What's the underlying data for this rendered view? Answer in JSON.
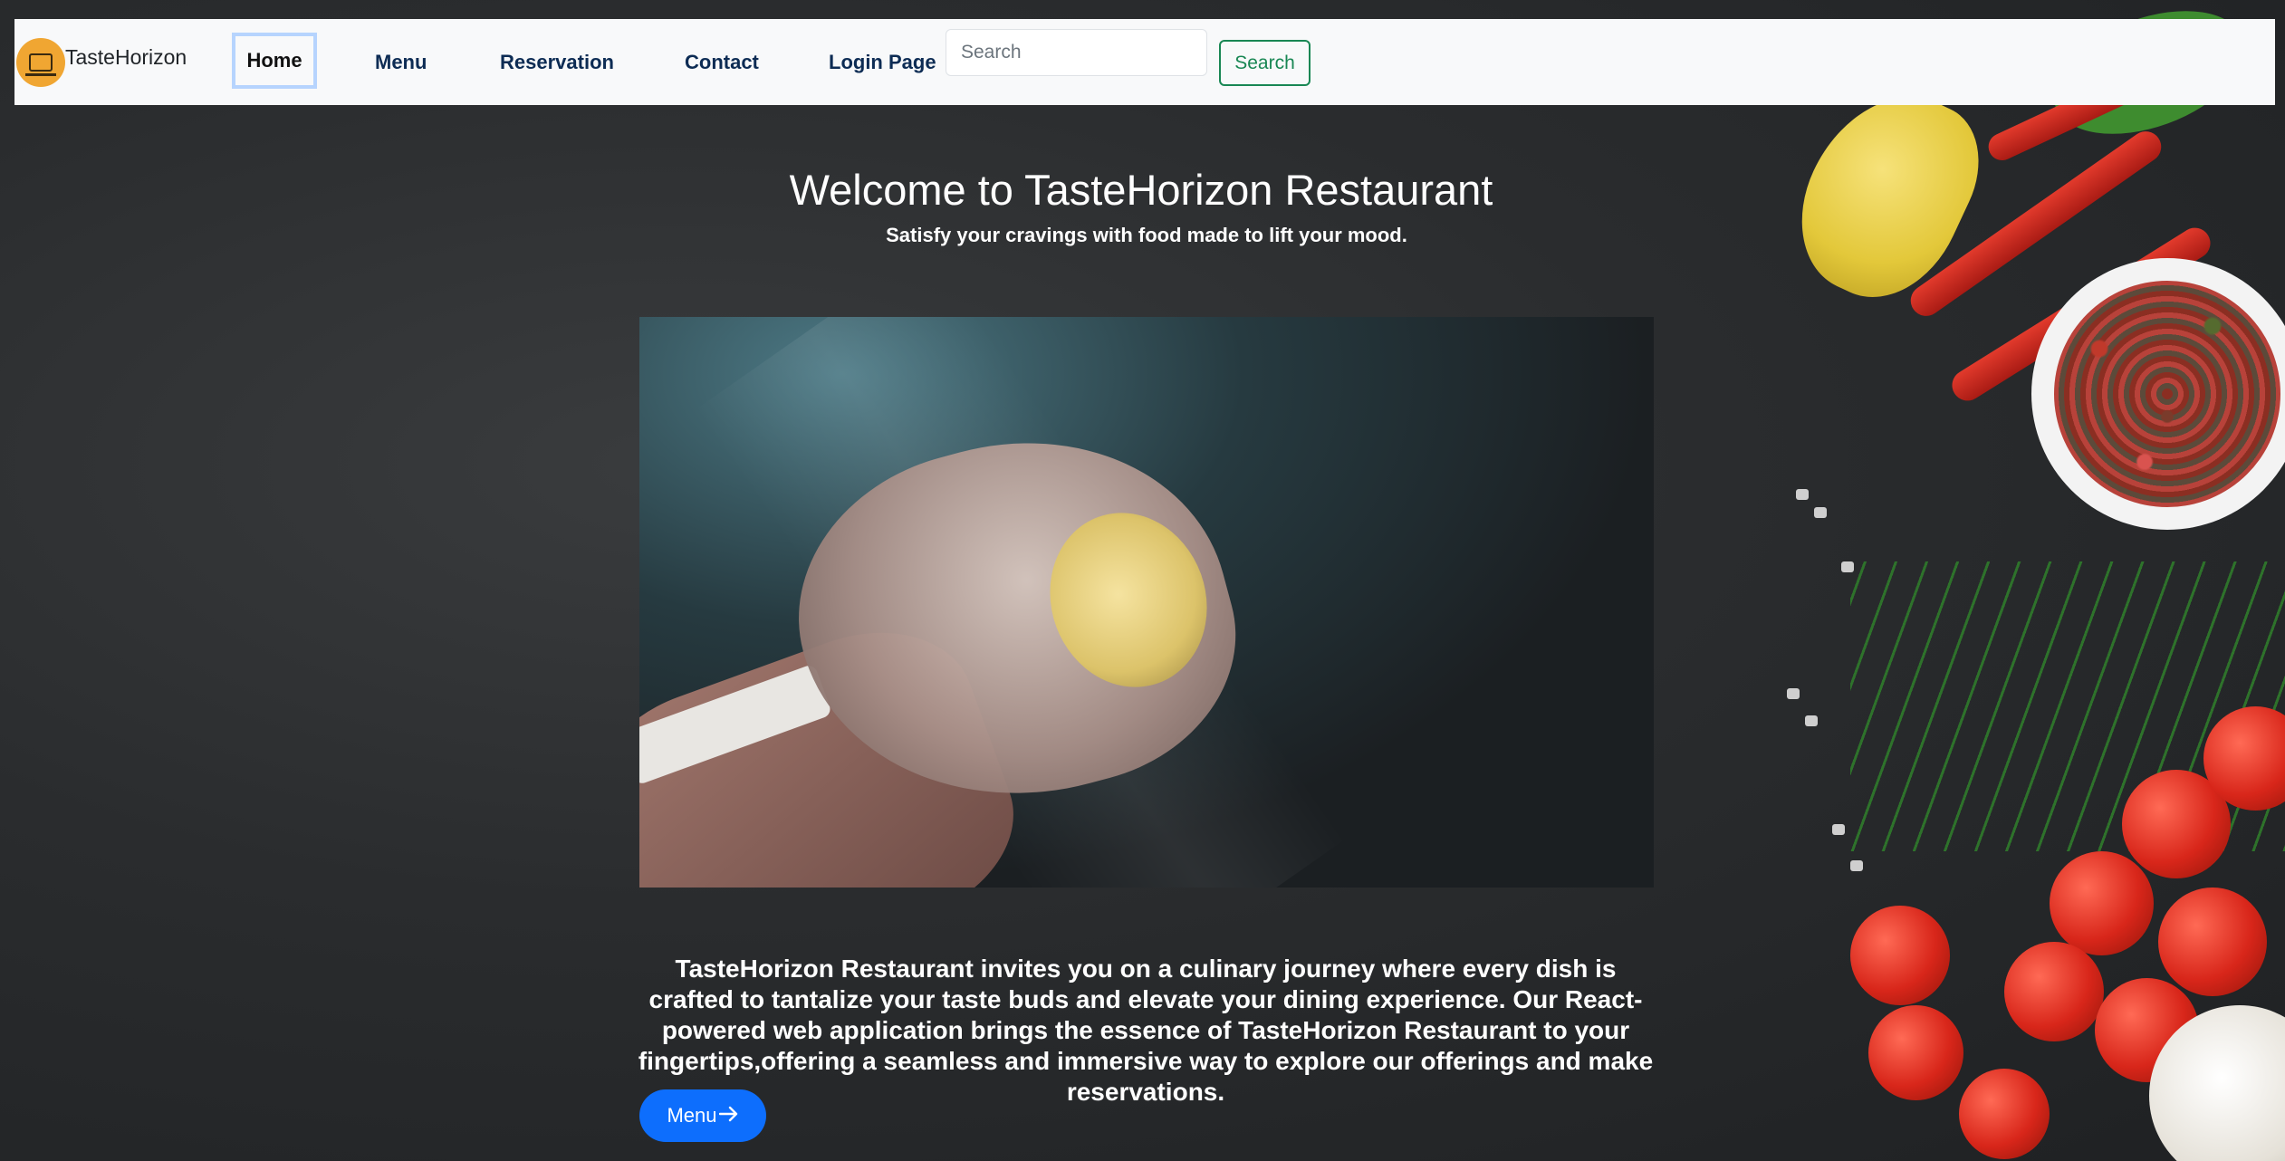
{
  "navbar": {
    "brand": "TasteHorizon",
    "links": [
      "Home",
      "Menu",
      "Reservation",
      "Contact",
      "Login Page"
    ],
    "search_placeholder": "Search",
    "search_button": "Search",
    "active": "Home"
  },
  "main": {
    "title": "Welcome to TasteHorizon Restaurant",
    "subtitle": "Satisfy your cravings with food made to lift your mood.",
    "description": "TasteHorizon Restaurant invites you on a culinary journey where every dish is crafted to tantalize your taste buds and elevate your dining experience. Our React-powered web application brings the essence of TasteHorizon Restaurant to your fingertips,offering a seamless and immersive way to explore our offerings and make reservations.",
    "menu_button": "Menu",
    "menu_button_icon": "arrow-right-icon"
  },
  "colors": {
    "accent": "#0d6efd",
    "search_button": "#198754",
    "navbar_bg": "#f8f9fa",
    "nav_text": "#0d2c54",
    "logo_bg": "#f0a632"
  }
}
